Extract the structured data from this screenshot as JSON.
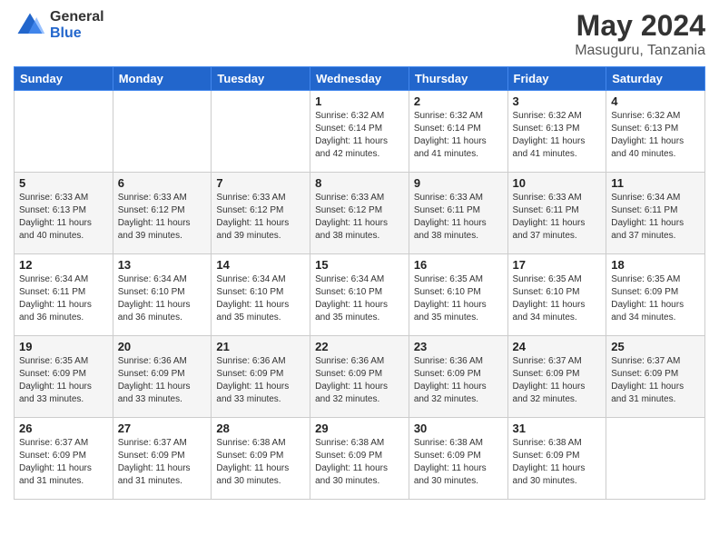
{
  "header": {
    "logo": {
      "general": "General",
      "blue": "Blue"
    },
    "title": "May 2024",
    "location": "Masuguru, Tanzania"
  },
  "columns": [
    "Sunday",
    "Monday",
    "Tuesday",
    "Wednesday",
    "Thursday",
    "Friday",
    "Saturday"
  ],
  "weeks": [
    [
      {
        "day": "",
        "info": ""
      },
      {
        "day": "",
        "info": ""
      },
      {
        "day": "",
        "info": ""
      },
      {
        "day": "1",
        "info": "Sunrise: 6:32 AM\nSunset: 6:14 PM\nDaylight: 11 hours\nand 42 minutes."
      },
      {
        "day": "2",
        "info": "Sunrise: 6:32 AM\nSunset: 6:14 PM\nDaylight: 11 hours\nand 41 minutes."
      },
      {
        "day": "3",
        "info": "Sunrise: 6:32 AM\nSunset: 6:13 PM\nDaylight: 11 hours\nand 41 minutes."
      },
      {
        "day": "4",
        "info": "Sunrise: 6:32 AM\nSunset: 6:13 PM\nDaylight: 11 hours\nand 40 minutes."
      }
    ],
    [
      {
        "day": "5",
        "info": "Sunrise: 6:33 AM\nSunset: 6:13 PM\nDaylight: 11 hours\nand 40 minutes."
      },
      {
        "day": "6",
        "info": "Sunrise: 6:33 AM\nSunset: 6:12 PM\nDaylight: 11 hours\nand 39 minutes."
      },
      {
        "day": "7",
        "info": "Sunrise: 6:33 AM\nSunset: 6:12 PM\nDaylight: 11 hours\nand 39 minutes."
      },
      {
        "day": "8",
        "info": "Sunrise: 6:33 AM\nSunset: 6:12 PM\nDaylight: 11 hours\nand 38 minutes."
      },
      {
        "day": "9",
        "info": "Sunrise: 6:33 AM\nSunset: 6:11 PM\nDaylight: 11 hours\nand 38 minutes."
      },
      {
        "day": "10",
        "info": "Sunrise: 6:33 AM\nSunset: 6:11 PM\nDaylight: 11 hours\nand 37 minutes."
      },
      {
        "day": "11",
        "info": "Sunrise: 6:34 AM\nSunset: 6:11 PM\nDaylight: 11 hours\nand 37 minutes."
      }
    ],
    [
      {
        "day": "12",
        "info": "Sunrise: 6:34 AM\nSunset: 6:11 PM\nDaylight: 11 hours\nand 36 minutes."
      },
      {
        "day": "13",
        "info": "Sunrise: 6:34 AM\nSunset: 6:10 PM\nDaylight: 11 hours\nand 36 minutes."
      },
      {
        "day": "14",
        "info": "Sunrise: 6:34 AM\nSunset: 6:10 PM\nDaylight: 11 hours\nand 35 minutes."
      },
      {
        "day": "15",
        "info": "Sunrise: 6:34 AM\nSunset: 6:10 PM\nDaylight: 11 hours\nand 35 minutes."
      },
      {
        "day": "16",
        "info": "Sunrise: 6:35 AM\nSunset: 6:10 PM\nDaylight: 11 hours\nand 35 minutes."
      },
      {
        "day": "17",
        "info": "Sunrise: 6:35 AM\nSunset: 6:10 PM\nDaylight: 11 hours\nand 34 minutes."
      },
      {
        "day": "18",
        "info": "Sunrise: 6:35 AM\nSunset: 6:09 PM\nDaylight: 11 hours\nand 34 minutes."
      }
    ],
    [
      {
        "day": "19",
        "info": "Sunrise: 6:35 AM\nSunset: 6:09 PM\nDaylight: 11 hours\nand 33 minutes."
      },
      {
        "day": "20",
        "info": "Sunrise: 6:36 AM\nSunset: 6:09 PM\nDaylight: 11 hours\nand 33 minutes."
      },
      {
        "day": "21",
        "info": "Sunrise: 6:36 AM\nSunset: 6:09 PM\nDaylight: 11 hours\nand 33 minutes."
      },
      {
        "day": "22",
        "info": "Sunrise: 6:36 AM\nSunset: 6:09 PM\nDaylight: 11 hours\nand 32 minutes."
      },
      {
        "day": "23",
        "info": "Sunrise: 6:36 AM\nSunset: 6:09 PM\nDaylight: 11 hours\nand 32 minutes."
      },
      {
        "day": "24",
        "info": "Sunrise: 6:37 AM\nSunset: 6:09 PM\nDaylight: 11 hours\nand 32 minutes."
      },
      {
        "day": "25",
        "info": "Sunrise: 6:37 AM\nSunset: 6:09 PM\nDaylight: 11 hours\nand 31 minutes."
      }
    ],
    [
      {
        "day": "26",
        "info": "Sunrise: 6:37 AM\nSunset: 6:09 PM\nDaylight: 11 hours\nand 31 minutes."
      },
      {
        "day": "27",
        "info": "Sunrise: 6:37 AM\nSunset: 6:09 PM\nDaylight: 11 hours\nand 31 minutes."
      },
      {
        "day": "28",
        "info": "Sunrise: 6:38 AM\nSunset: 6:09 PM\nDaylight: 11 hours\nand 30 minutes."
      },
      {
        "day": "29",
        "info": "Sunrise: 6:38 AM\nSunset: 6:09 PM\nDaylight: 11 hours\nand 30 minutes."
      },
      {
        "day": "30",
        "info": "Sunrise: 6:38 AM\nSunset: 6:09 PM\nDaylight: 11 hours\nand 30 minutes."
      },
      {
        "day": "31",
        "info": "Sunrise: 6:38 AM\nSunset: 6:09 PM\nDaylight: 11 hours\nand 30 minutes."
      },
      {
        "day": "",
        "info": ""
      }
    ]
  ]
}
